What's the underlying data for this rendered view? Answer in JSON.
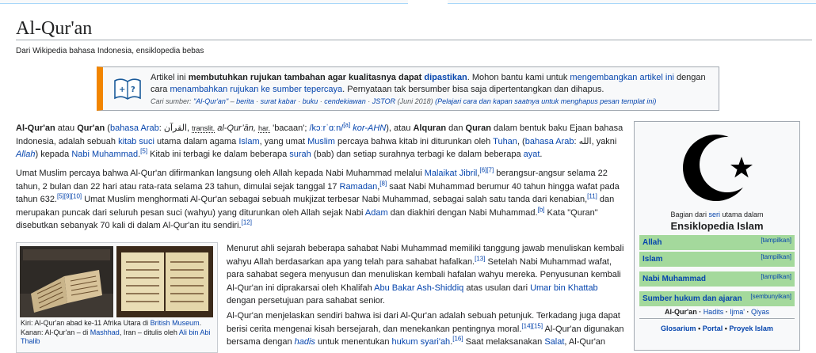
{
  "page": {
    "title": "Al-Qur'an",
    "tagline": "Dari Wikipedia bahasa Indonesia, ensiklopedia bebas"
  },
  "ambox": {
    "t1": "Artikel ini ",
    "t2": "membutuhkan rujukan tambahan agar kualitasnya dapat ",
    "t3": "dipastikan",
    "t4": ". Mohon bantu kami untuk ",
    "t5": "mengembangkan artikel ini",
    "t6": " dengan cara ",
    "t7": "menambahkan rujukan ke sumber tepercaya",
    "t8": ". Pernyataan tak bersumber bisa saja dipertentangkan dan dihapus.",
    "s1": "Cari sumber: ",
    "s2": "\"Al-Qur'an\"",
    "s3": " – ",
    "s4": "berita",
    "s5": " · ",
    "s6": "surat kabar",
    "s7": " · ",
    "s8": "buku",
    "s9": " · ",
    "s10": "cendekiawan",
    "s11": " · ",
    "s12": "JSTOR",
    "s13": " (Juni 2018) ",
    "s14": "(Pelajari cara dan kapan saatnya untuk menghapus pesan templat ini)"
  },
  "p1": {
    "a": "Al-Qur'an",
    "b": " atau ",
    "c": "Qur'an",
    "d": " (",
    "e": "bahasa Arab",
    "f": ": القرآن, ",
    "g": "translit.",
    "h": " al-Qur’ān, ",
    "i": "har.",
    "j": " 'bacaan'; ",
    "k": "/kɔːrˈɑːn/",
    "l": "[a]",
    "m": " kor-AHN",
    "n": "), atau ",
    "o": "Alquran",
    "p": " dan ",
    "q": "Quran",
    "r": " dalam bentuk baku Ejaan bahasa Indonesia, adalah sebuah ",
    "s": "kitab suci",
    "t": " utama dalam agama ",
    "u": "Islam",
    "v": ", yang umat ",
    "w": "Muslim",
    "x": " percaya bahwa kitab ini diturunkan oleh ",
    "y": "Tuhan",
    "z": ", (",
    "aa": "bahasa Arab",
    "ab": ": الله, yakni ",
    "ac": "Allah",
    "ad": ") kepada ",
    "ae": "Nabi Muhammad",
    "af": ".",
    "ag": "[5]",
    "ah": " Kitab ini terbagi ke dalam beberapa ",
    "ai": "surah",
    "aj": " (bab) dan setiap surahnya terbagi ke dalam beberapa ",
    "ak": "ayat",
    "al": "."
  },
  "p2": {
    "a": "Umat Muslim percaya bahwa Al-Qur'an difirmankan langsung oleh Allah kepada Nabi Muhammad melalui ",
    "b": "Malaikat Jibril",
    "c": ",",
    "d": "[6][7]",
    "e": " berangsur-angsur selama 22 tahun, 2 bulan dan 22 hari atau rata-rata selama 23 tahun, dimulai sejak tanggal 17 ",
    "f": "Ramadan",
    "g": ",",
    "h": "[8]",
    "i": " saat Nabi Muhammad berumur 40 tahun hingga wafat pada tahun 632.",
    "j": "[5][9][10]",
    "k": " Umat Muslim menghormati Al-Qur'an sebagai sebuah mukjizat terbesar Nabi Muhammad, sebagai salah satu tanda dari kenabian,",
    "l": "[11]",
    "m": " dan merupakan puncak dari seluruh pesan suci (wahyu) yang diturunkan oleh Allah sejak Nabi ",
    "n": "Adam",
    "o": " dan diakhiri dengan Nabi Muhammad.",
    "p": "[b]",
    "q": " Kata \"Quran\" disebutkan sebanyak 70 kali di dalam Al-Qur'an itu sendiri.",
    "r": "[12]"
  },
  "p3": {
    "a": "Menurut ahli sejarah beberapa sahabat Nabi Muhammad memiliki tanggung jawab menuliskan kembali wahyu Allah berdasarkan apa yang telah para sahabat hafalkan.",
    "b": "[13]",
    "c": " Setelah Nabi Muhammad wafat, para sahabat segera menyusun dan menuliskan kembali hafalan wahyu mereka. Penyusunan kembali Al-Qur'an ini diprakarsai oleh Khalifah ",
    "d": "Abu Bakar Ash-Shiddiq",
    "e": " atas usulan dari ",
    "f": "Umar bin Khattab",
    "g": " dengan persetujuan para sahabat senior."
  },
  "p4": {
    "a": "Al-Qur'an menjelaskan sendiri bahwa isi dari Al-Qur'an adalah sebuah petunjuk. Terkadang juga dapat berisi cerita mengenai kisah bersejarah, dan menekankan pentingnya moral.",
    "b": "[14][15]",
    "c": " Al-Qur'an digunakan bersama dengan ",
    "d": "hadis",
    "e": " untuk menentukan ",
    "f": "hukum syari'ah",
    "g": ".",
    "h": "[16]",
    "i": " Saat melaksanakan ",
    "j": "Salat",
    "k": ", Al-Qur'an"
  },
  "thumb": {
    "c1": "Kiri: Al-Qur'an abad ke-11 Afrika Utara di ",
    "c2": "British Museum",
    "c3": ". Kanan: Al-Qur'an – di ",
    "c4": "Mashhad",
    "c5": ", Iran – ditulis oleh ",
    "c6": "Ali bin Abi Thalib"
  },
  "sidebar": {
    "intro1": "Bagian dari ",
    "intro2": "seri",
    "intro3": " utama dalam",
    "title": "Ensiklopedia Islam",
    "rows": [
      {
        "label": "Allah",
        "toggle": "[tampilkan]"
      },
      {
        "label": "Islam",
        "toggle": "[tampilkan]"
      },
      {
        "label": "Nabi Muhammad",
        "toggle": "[tampilkan]"
      },
      {
        "label": "Sumber hukum dan ajaran",
        "toggle": "[sembunyikan]"
      }
    ],
    "sub1": "Al-Qur'an",
    "sub2": " · ",
    "sub3": "Hadits",
    "sub4": " · ",
    "sub5": "Ijma'",
    "sub6": " · ",
    "sub7": "Qiyas",
    "f1": "Glosarium",
    "f2": " • ",
    "f3": "Portal",
    "f4": " • ",
    "f5": "Proyek Islam"
  },
  "colors": {
    "link": "#0645ad",
    "ambox_border": "#f28500",
    "sidebar_row": "#a4d99c"
  }
}
